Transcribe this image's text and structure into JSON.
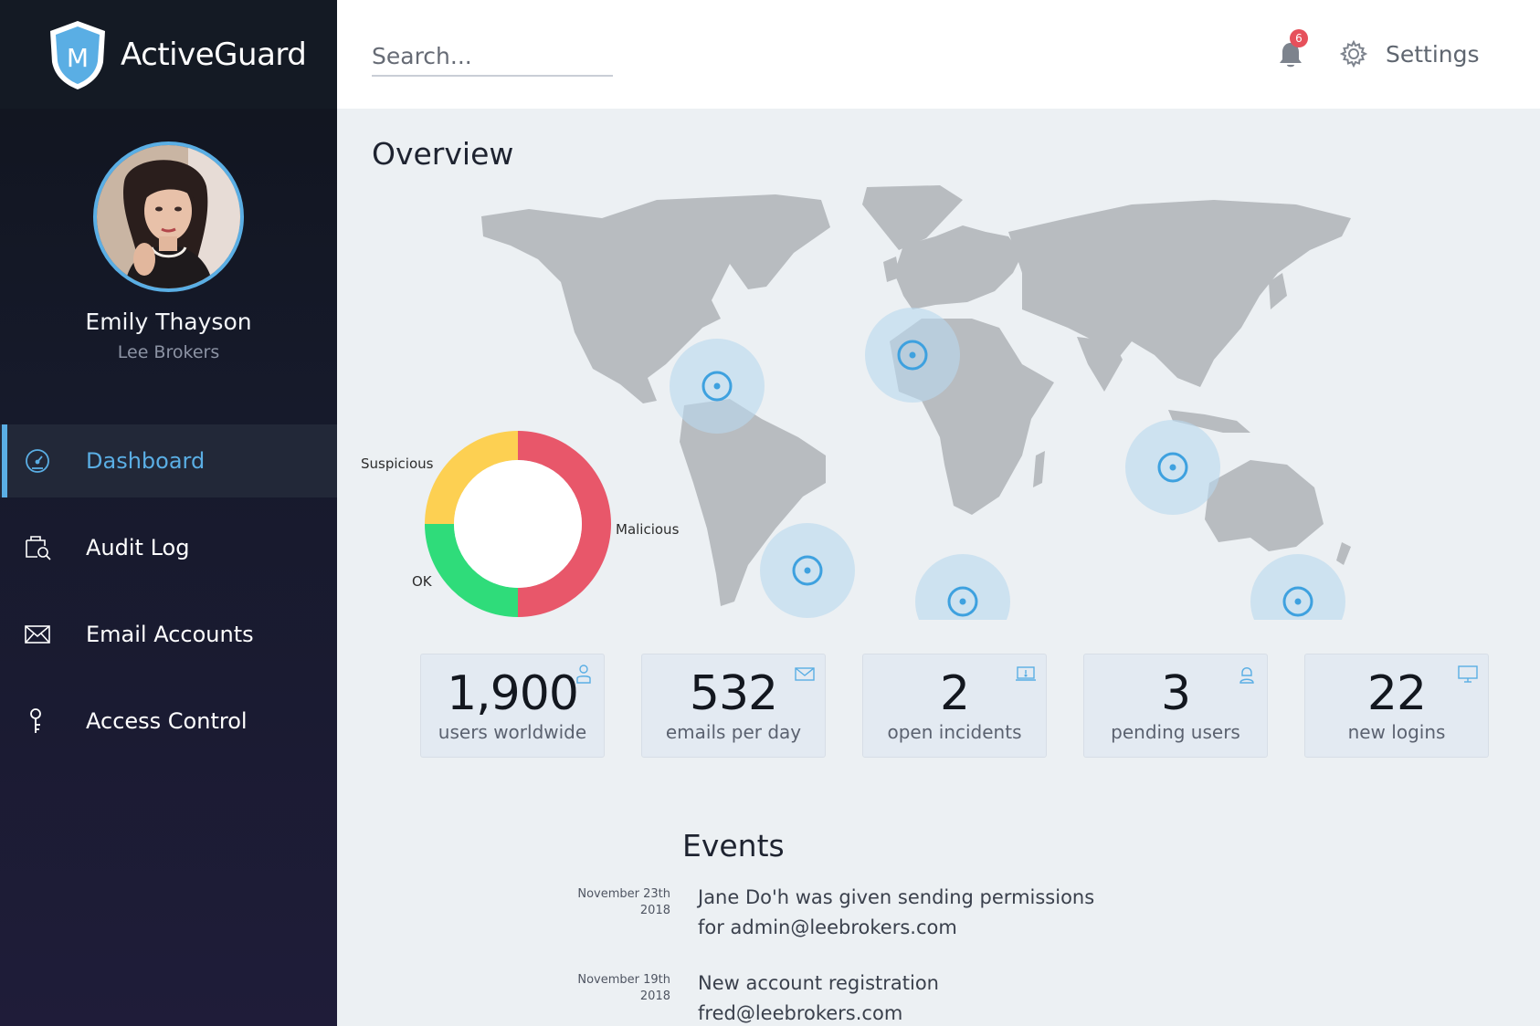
{
  "app": {
    "name": "ActiveGuard",
    "logo_letter": "M"
  },
  "user": {
    "name": "Emily Thayson",
    "company": "Lee Brokers"
  },
  "nav": {
    "items": [
      {
        "label": "Dashboard",
        "icon": "speedometer-icon",
        "active": true
      },
      {
        "label": "Audit Log",
        "icon": "audit-search-icon",
        "active": false
      },
      {
        "label": "Email Accounts",
        "icon": "envelope-icon",
        "active": false
      },
      {
        "label": "Access Control",
        "icon": "key-icon",
        "active": false
      }
    ]
  },
  "topbar": {
    "search_placeholder": "Search...",
    "notifications_count": "6",
    "settings_label": "Settings"
  },
  "overview": {
    "title": "Overview",
    "donut": {
      "labels": {
        "suspicious": "Suspicious",
        "malicious": "Malicious",
        "ok": "OK"
      },
      "segments": [
        {
          "name": "Malicious",
          "fraction": 0.5,
          "color": "#e8576a"
        },
        {
          "name": "OK",
          "fraction": 0.25,
          "color": "#2fdc7a"
        },
        {
          "name": "Suspicious",
          "fraction": 0.25,
          "color": "#fdd052"
        }
      ]
    },
    "map_markers": [
      "North America East",
      "Western Europe",
      "Southeast Asia",
      "South America",
      "Southern Africa",
      "Australia"
    ]
  },
  "stats": [
    {
      "value": "1,900",
      "label": "users worldwide",
      "icon": "user-icon"
    },
    {
      "value": "532",
      "label": "emails per day",
      "icon": "envelope-icon"
    },
    {
      "value": "2",
      "label": "open incidents",
      "icon": "laptop-alert-icon"
    },
    {
      "value": "3",
      "label": "pending users",
      "icon": "user-pending-icon"
    },
    {
      "value": "22",
      "label": "new logins",
      "icon": "monitor-icon"
    }
  ],
  "events": {
    "title": "Events",
    "items": [
      {
        "date_line1": "November 23th",
        "date_line2": "2018",
        "text": "Jane Do'h was given sending permissions for admin@leebrokers.com"
      },
      {
        "date_line1": "November 19th",
        "date_line2": "2018",
        "text": "New account registration fred@leebrokers.com"
      }
    ]
  },
  "colors": {
    "accent": "#5aaee4",
    "sidebar": "#161a2b",
    "malicious": "#e8576a",
    "ok": "#2fdc7a",
    "suspicious": "#fdd052"
  }
}
